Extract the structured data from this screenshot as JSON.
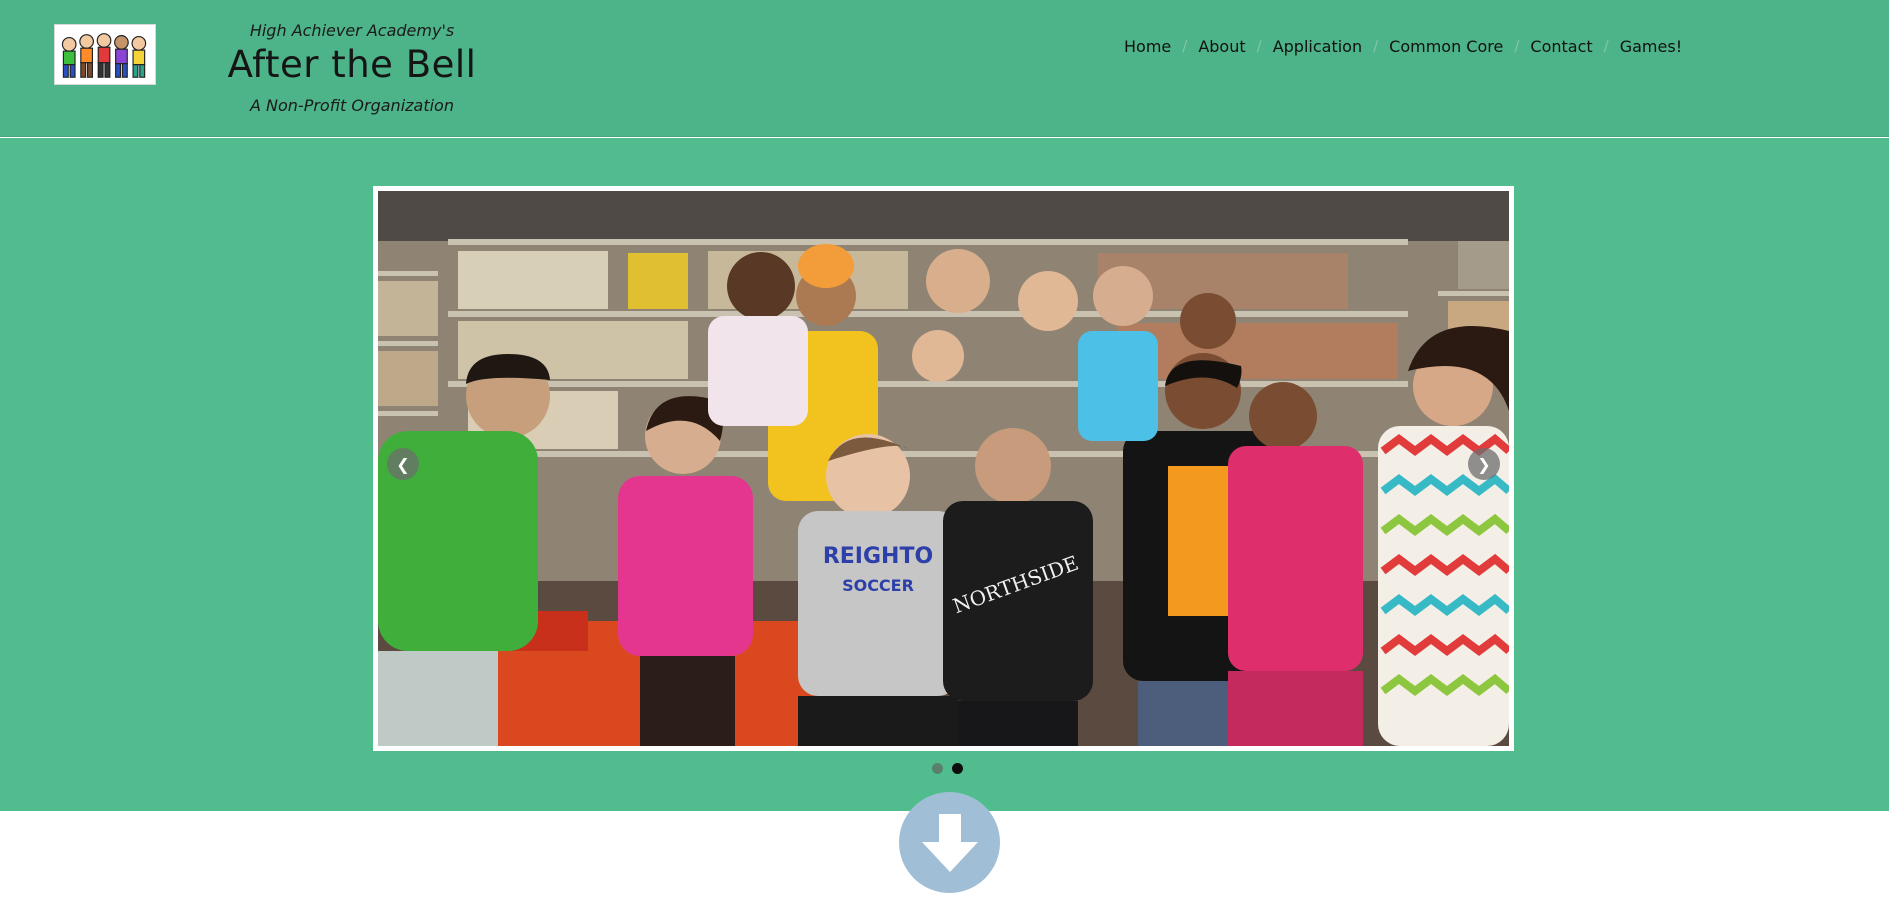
{
  "header": {
    "brand_top": "High Achiever Academy's",
    "brand_title": "After the Bell",
    "brand_bottom": "A Non-Profit Organization",
    "logo_icon": "children-group-logo"
  },
  "nav": {
    "items": [
      "Home",
      "About",
      "Application",
      "Common Core",
      "Contact",
      "Games!"
    ],
    "separator": "/"
  },
  "carousel": {
    "slide_image": "group-of-children-in-library-photo",
    "prev_icon": "chevron-left-icon",
    "next_icon": "chevron-right-icon",
    "slide_count": 2,
    "active_slide": 2
  },
  "scroll_button": {
    "icon": "arrow-down-icon"
  },
  "colors": {
    "header_bg": "#4db389",
    "hero_bg": "#51bd8e",
    "scroll_button": "#a0bfd7"
  }
}
